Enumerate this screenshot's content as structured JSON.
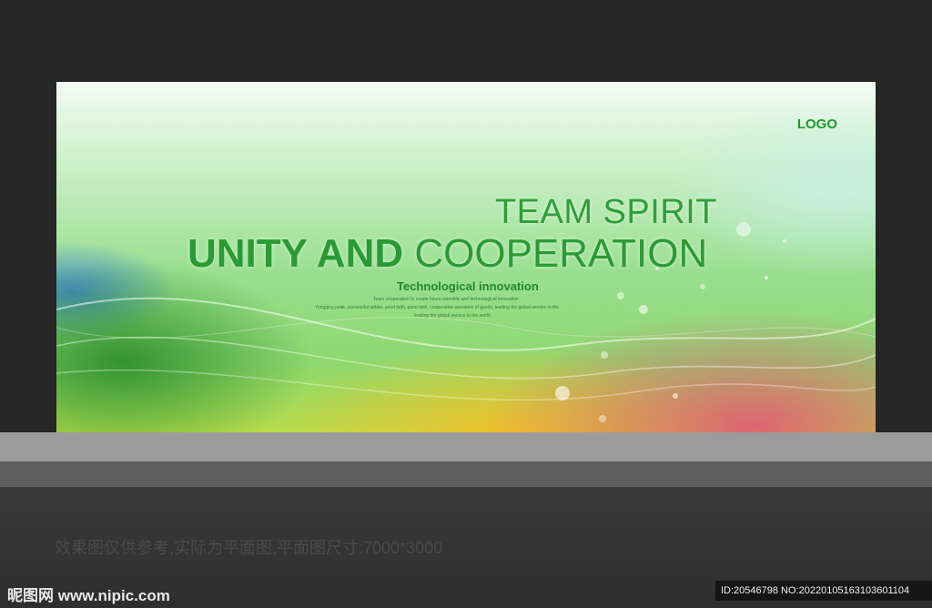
{
  "board": {
    "logo": "LOGO",
    "headline_line1": "TEAM SPIRIT",
    "headline_line2_bold": "UNITY AND",
    "headline_line2_light": "COOPERATION",
    "subtitle": "Technological innovation",
    "small_text": [
      "Team cooperation to create future scientific and technological innovation",
      "Yongqing peak, successful ladder, good faith, good faith, cooperative operation of goods, leading the global service to the",
      "leading the global service to the world"
    ]
  },
  "footer": {
    "caption": "效果图仅供参考,实际为平面图,平面图尺寸:7000*3000",
    "site": "昵图网 www.nipic.com",
    "id_text": "ID:20546798 NO:20220105163103601104"
  },
  "colors": {
    "headline": "#2a9a35",
    "logo": "#1f9a2c",
    "backdrop": "#262626",
    "stage": "#9b9b9b"
  }
}
